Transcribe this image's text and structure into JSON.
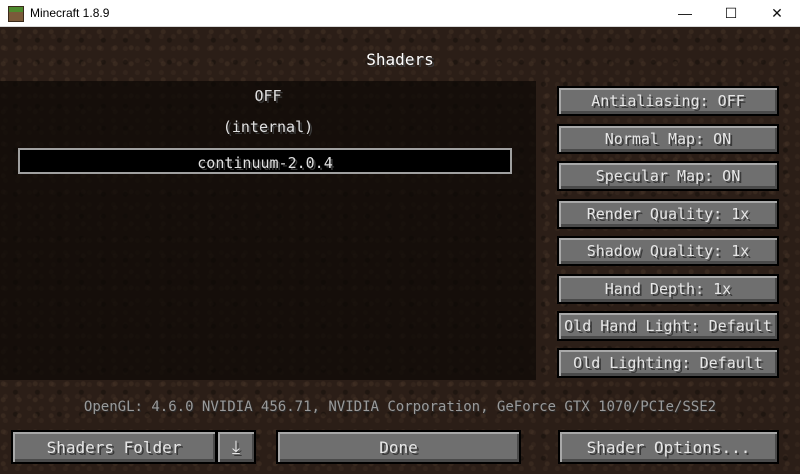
{
  "window": {
    "title": "Minecraft 1.8.9",
    "minimize_glyph": "—",
    "maximize_glyph": "☐",
    "close_glyph": "✕"
  },
  "screen": {
    "title": "Shaders"
  },
  "shader_list": {
    "items": [
      "OFF",
      "(internal)",
      "continuum-2.0.4"
    ],
    "selected_index": 2
  },
  "options": [
    "Antialiasing: OFF",
    "Normal Map: ON",
    "Specular Map: ON",
    "Render Quality: 1x",
    "Shadow Quality: 1x",
    "Hand Depth: 1x",
    "Old Hand Light: Default",
    "Old Lighting: Default"
  ],
  "gl_info": "OpenGL: 4.6.0 NVIDIA 456.71, NVIDIA Corporation, GeForce GTX 1070/PCIe/SSE2",
  "bottom": {
    "shaders_folder": "Shaders Folder",
    "download_icon": "download-icon",
    "download_glyph": "⤓",
    "done": "Done",
    "shader_options": "Shader Options..."
  }
}
